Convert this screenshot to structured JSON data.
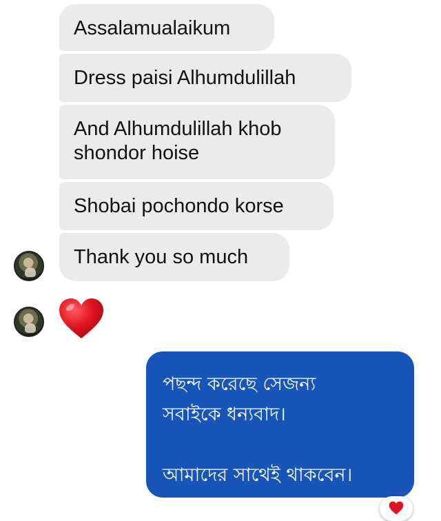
{
  "conversation": {
    "incoming": [
      {
        "text": "Assalamualaikum"
      },
      {
        "text": "Dress paisi Alhumdulillah"
      },
      {
        "text": "And Alhumdulillah khob\nshondor hoise"
      },
      {
        "text": "Shobai pochondo korse"
      },
      {
        "text": "Thank you so much"
      }
    ],
    "heart_reply": {
      "emoji": "heart-emoji",
      "color": "#e0141e"
    },
    "outgoing": {
      "line1": "পছন্দ করেছে সেজন্য",
      "line2": "সবাইকে ধন্যবাদ।",
      "line3": "",
      "line4": "আমাদের সাথেই থাকবেন।",
      "bubble_color": "#1756b8"
    },
    "reaction": {
      "emoji": "heart-emoji",
      "color": "#e0141e"
    }
  },
  "colors": {
    "incoming_bubble": "#ebebeb",
    "outgoing_bubble": "#1756b8",
    "background": "#ffffff"
  }
}
